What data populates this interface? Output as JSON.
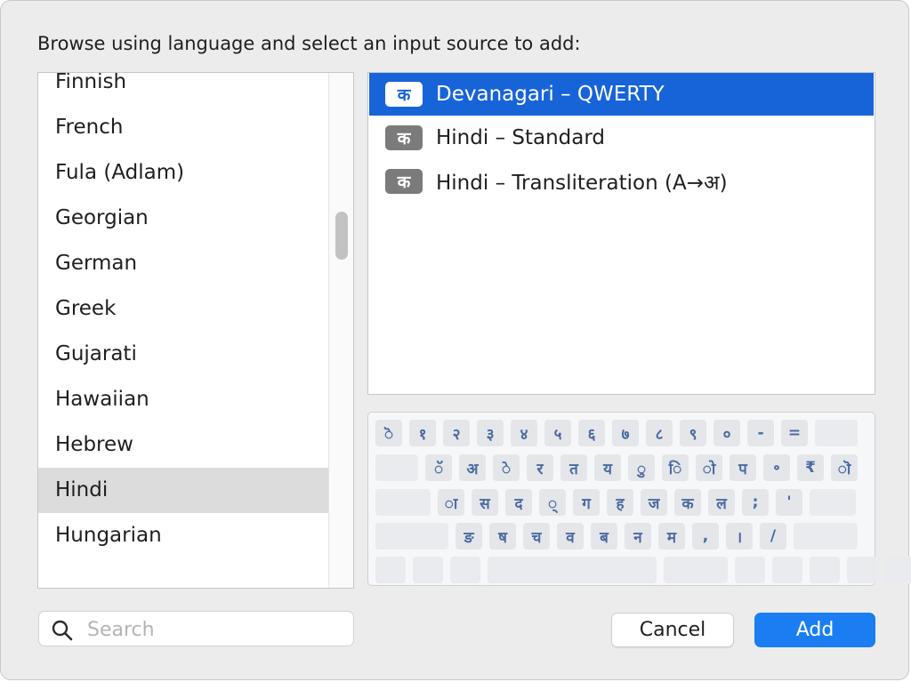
{
  "dialog": {
    "prompt": "Browse using language and select an input source to add:"
  },
  "languages": [
    {
      "label": "Finnish",
      "selected": false
    },
    {
      "label": "French",
      "selected": false
    },
    {
      "label": "Fula (Adlam)",
      "selected": false
    },
    {
      "label": "Georgian",
      "selected": false
    },
    {
      "label": "German",
      "selected": false
    },
    {
      "label": "Greek",
      "selected": false
    },
    {
      "label": "Gujarati",
      "selected": false
    },
    {
      "label": "Hawaiian",
      "selected": false
    },
    {
      "label": "Hebrew",
      "selected": false
    },
    {
      "label": "Hindi",
      "selected": true
    },
    {
      "label": "Hungarian",
      "selected": false
    }
  ],
  "sources": [
    {
      "badge": "क",
      "label": "Devanagari – QWERTY",
      "selected": true
    },
    {
      "badge": "क",
      "label": "Hindi – Standard",
      "selected": false
    },
    {
      "badge": "क",
      "label": "Hindi – Transliteration (A→अ)",
      "selected": false
    }
  ],
  "keyboard": {
    "rows": [
      [
        "ॆ",
        "१",
        "२",
        "३",
        "४",
        "५",
        "६",
        "७",
        "८",
        "९",
        "०",
        "-",
        "=",
        ""
      ],
      [
        "",
        "ॅ",
        "अ",
        "े",
        "र",
        "त",
        "य",
        "ु",
        "ि",
        "ो",
        "प",
        "॰",
        "₹",
        "ॊ"
      ],
      [
        "",
        "ा",
        "स",
        "द",
        "्",
        "ग",
        "ह",
        "ज",
        "क",
        "ल",
        ";",
        "'",
        ""
      ],
      [
        "",
        "ङ",
        "ष",
        "च",
        "व",
        "ब",
        "न",
        "म",
        ",",
        "।",
        "/",
        ""
      ],
      [
        "",
        "",
        "",
        "",
        "",
        "",
        "",
        "",
        "",
        ""
      ]
    ]
  },
  "search": {
    "placeholder": "Search",
    "value": ""
  },
  "buttons": {
    "cancel": "Cancel",
    "add": "Add"
  },
  "colors": {
    "accent": "#1a7ef2",
    "selection": "#1764d9",
    "key_text": "#4b6aa0"
  }
}
